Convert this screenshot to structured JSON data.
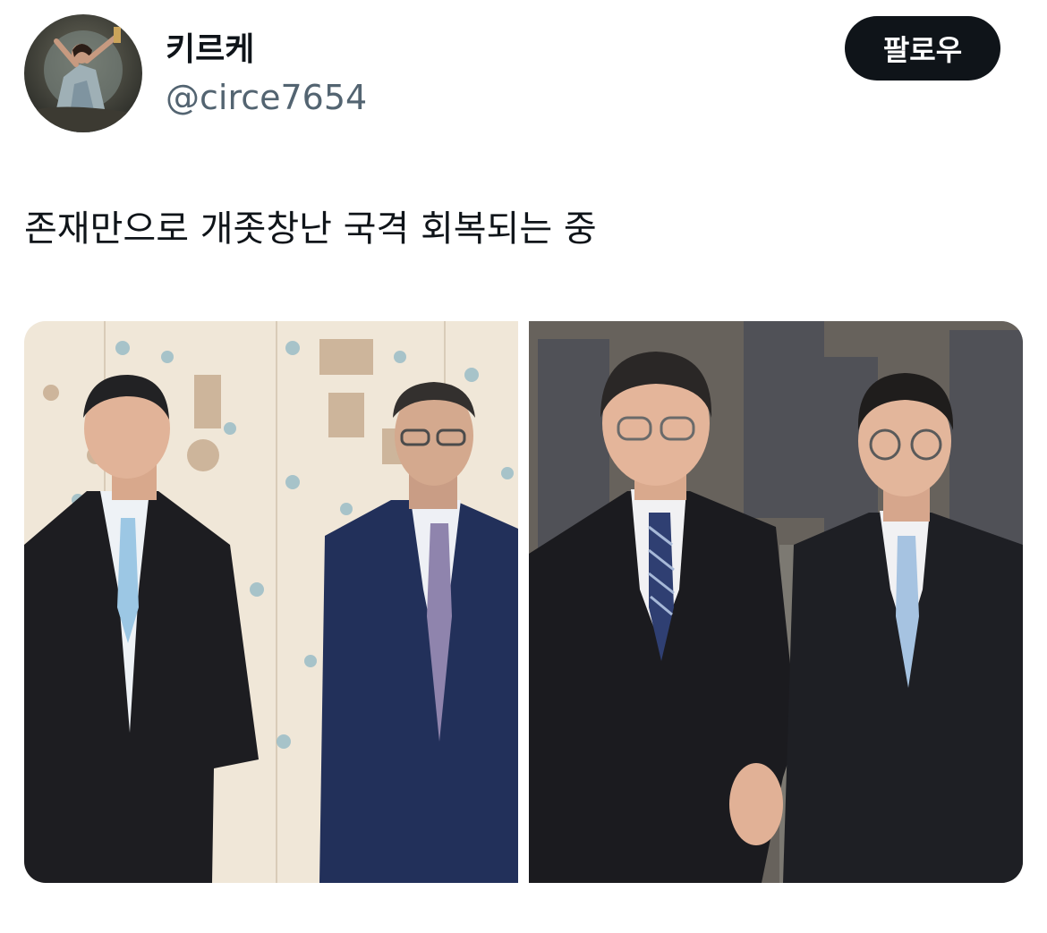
{
  "user": {
    "display_name": "키르케",
    "handle": "@circe7654",
    "avatar_icon": "avatar-painting"
  },
  "actions": {
    "follow_label": "팔로우"
  },
  "tweet": {
    "text": "존재만으로 개좃창난 국격 회복되는 중"
  },
  "media": {
    "photos": [
      {
        "icon": "photo-two-men-folding-screen"
      },
      {
        "icon": "photo-two-men-holding-hands"
      }
    ]
  },
  "colors": {
    "text_primary": "#0f1419",
    "text_secondary": "#536471",
    "button_bg": "#0f1419",
    "button_text": "#ffffff"
  }
}
